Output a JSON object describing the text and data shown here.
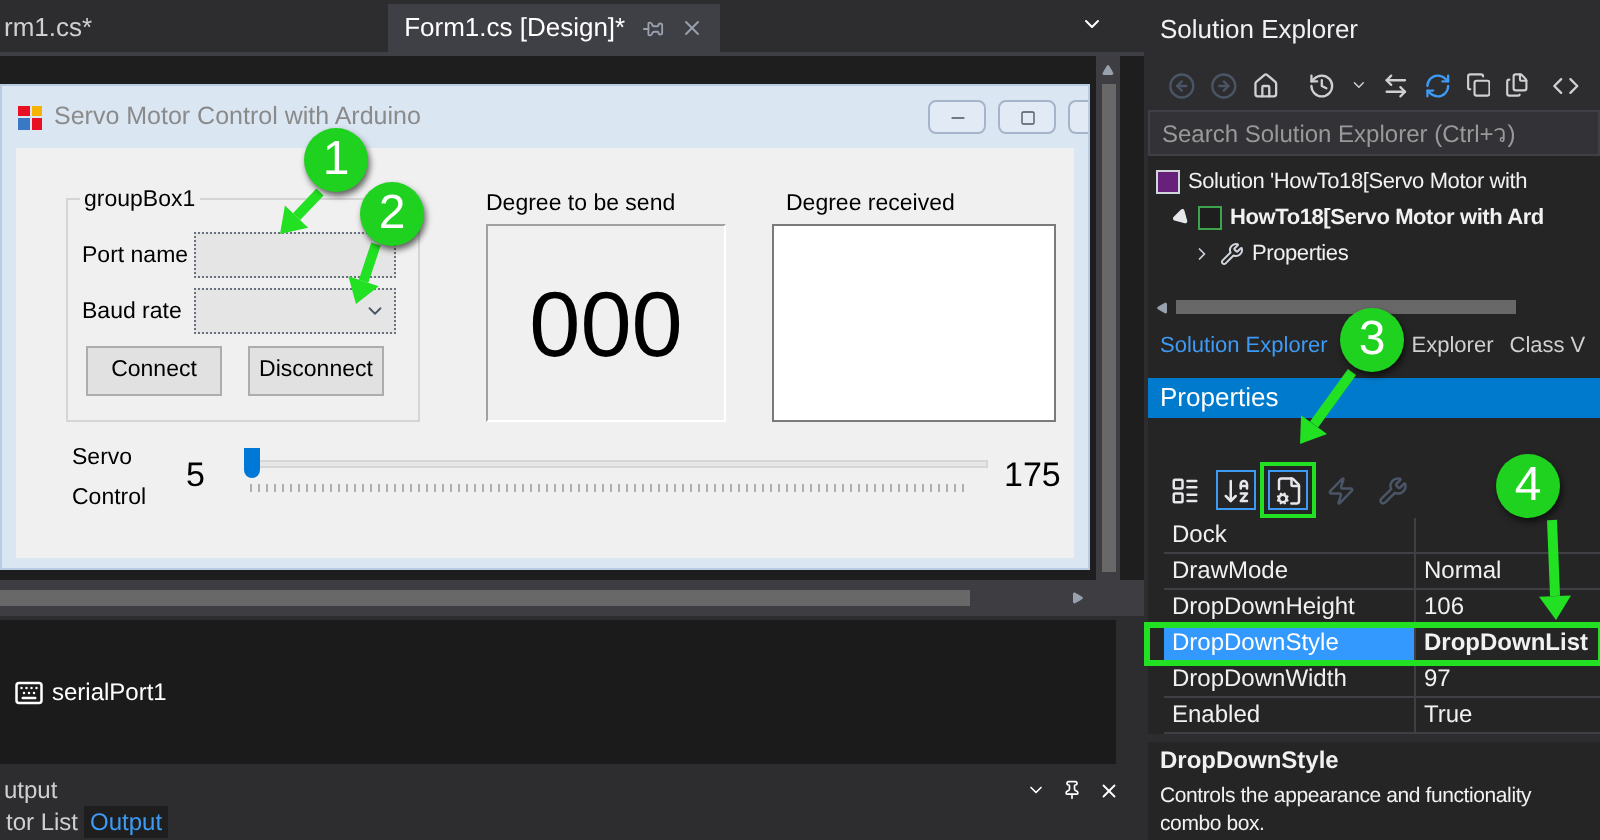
{
  "editor_tabs": [
    {
      "label": "rm1.cs*",
      "selected": false
    },
    {
      "label": "Form1.cs [Design]*",
      "selected": true
    }
  ],
  "form": {
    "title": "Servo Motor Control with Arduino",
    "group_box": {
      "title": "groupBox1",
      "fields": [
        {
          "label": "Port name",
          "kind": "plain"
        },
        {
          "label": "Baud rate",
          "kind": "dropdown"
        }
      ],
      "buttons": [
        "Connect",
        "Disconnect"
      ]
    },
    "send_panel": {
      "label": "Degree to be send",
      "value": "000"
    },
    "received_box": {
      "label": "Degree received"
    },
    "servo": {
      "label_lines": [
        "Servo",
        "Control"
      ],
      "min": "5",
      "max": "175",
      "level": 0
    }
  },
  "component_tray": [
    {
      "name": "serialPort1"
    }
  ],
  "bottom_panel": {
    "title": "utput",
    "tabs": [
      {
        "label": "tor List",
        "selected": false
      },
      {
        "label": "Output",
        "selected": true
      }
    ]
  },
  "solution_explorer": {
    "title": "Solution Explorer",
    "search": {
      "placeholder": "Search Solution Explorer (Ctrl+ว)"
    },
    "tree": [
      {
        "label": "Solution 'HowTo18[Servo Motor with",
        "kind": "solution",
        "children": [
          {
            "label": "HowTo18[Servo Motor with Ard",
            "kind": "project",
            "expanded": true,
            "children": [
              {
                "label": "Properties",
                "kind": "properties",
                "expanded": false
              }
            ]
          }
        ]
      }
    ],
    "tabs": [
      {
        "label": "Solution Explorer",
        "selected": true
      },
      {
        "label": "Explorer",
        "selected": false
      },
      {
        "label": "Class V",
        "selected": false
      }
    ]
  },
  "properties": {
    "title": "Properties",
    "toolbar": [
      {
        "kind": "categorized",
        "selected": false
      },
      {
        "kind": "alphabetical",
        "selected": true
      },
      {
        "kind": "properties",
        "selected": true
      },
      {
        "kind": "events",
        "selected": false
      },
      {
        "kind": "pages",
        "selected": false
      }
    ],
    "rows": [
      {
        "name": "Dock",
        "selected": false
      },
      {
        "name": "DrawMode",
        "value": "Normal",
        "selected": false
      },
      {
        "name": "DropDownHeight",
        "value": "106",
        "selected": false
      },
      {
        "name": "DropDownStyle",
        "value": "DropDownList",
        "selected": true
      },
      {
        "name": "DropDownWidth",
        "value": "97",
        "selected": false
      },
      {
        "name": "Enabled",
        "value": "True",
        "selected": false
      }
    ],
    "description": {
      "title": "DropDownStyle",
      "lines": [
        "Controls the appearance and functionality",
        "combo box."
      ]
    }
  },
  "annotations": [
    {
      "number": "1"
    },
    {
      "number": "2"
    },
    {
      "number": "3"
    },
    {
      "number": "4"
    }
  ]
}
